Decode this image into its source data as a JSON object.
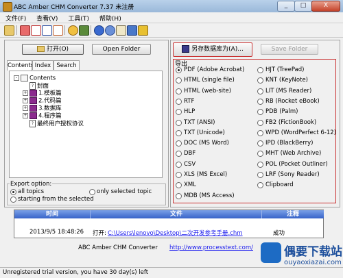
{
  "window": {
    "title": "ABC Amber CHM Converter 7.37 未注册",
    "minimize": "_",
    "maximize": "□",
    "close": "X"
  },
  "menu": [
    "文件(F)",
    "查看(V)",
    "工具(T)",
    "帮助(H)"
  ],
  "left": {
    "open_button": "打开(O)",
    "open_folder": "Open Folder",
    "tabs": [
      "Contents",
      "Index",
      "Search"
    ],
    "tree": [
      {
        "label": "Contents",
        "level": 0,
        "kind": "book-open",
        "expander": "-"
      },
      {
        "label": "封面",
        "level": 1,
        "kind": "page",
        "expander": ""
      },
      {
        "label": "1.模板篇",
        "level": 1,
        "kind": "book",
        "expander": "+"
      },
      {
        "label": "2.代码篇",
        "level": 1,
        "kind": "book",
        "expander": "+"
      },
      {
        "label": "3.数据库",
        "level": 1,
        "kind": "book",
        "expander": "+"
      },
      {
        "label": "4.程序篇",
        "level": 1,
        "kind": "book",
        "expander": "+"
      },
      {
        "label": "最终用户授权协议",
        "level": 1,
        "kind": "page",
        "expander": ""
      }
    ],
    "export_option": {
      "title": "Export option:",
      "all_topics": "all topics",
      "only_selected": "only selected topic",
      "starting_from": "starting from the selected"
    }
  },
  "right": {
    "save_as": "另存数据库为(A)...",
    "save_folder": "Save Folder",
    "export_title": "导出",
    "formats_left": [
      "PDF (Adobe Acrobat)",
      "HTML (single file)",
      "HTML (web-site)",
      "RTF",
      "HLP",
      "TXT (ANSI)",
      "TXT (Unicode)",
      "DOC (MS Word)",
      "DBF",
      "CSV",
      "XLS (MS Excel)",
      "XML",
      "MDB (MS Access)"
    ],
    "formats_right": [
      "HJT (TreePad)",
      "KNT (KeyNote)",
      "LIT (MS Reader)",
      "RB (Rocket eBook)",
      "PDB (Palm)",
      "FB2 (FictionBook)",
      "WPD (WordPerfect 6-12)",
      "IPD (BlackBerry)",
      "MHT (Web Archive)",
      "POL (Pocket Outliner)",
      "LRF (Sony Reader)",
      "Clipboard"
    ],
    "selected": "PDF (Adobe Acrobat)"
  },
  "log": {
    "headers": [
      "时间",
      "文件",
      "注释"
    ],
    "row": {
      "time": "2013/9/5 18:48:26",
      "action": "打开:",
      "path": "C:\\Users\\lenovo\\Desktop\\二次开发参考手册.chm",
      "note": "成功"
    }
  },
  "footer_text": "ABC Amber CHM Converter",
  "footer_link": "http://www.processtext.com/",
  "status": "Unregistered trial version, you have 30 day(s) left",
  "watermark": {
    "brand": "偶要下载站",
    "domain": "ouyaoxiazai.com"
  },
  "colors": {
    "highlight": "#c93030",
    "log_header": "#3763c8",
    "link": "#1a1aee"
  }
}
